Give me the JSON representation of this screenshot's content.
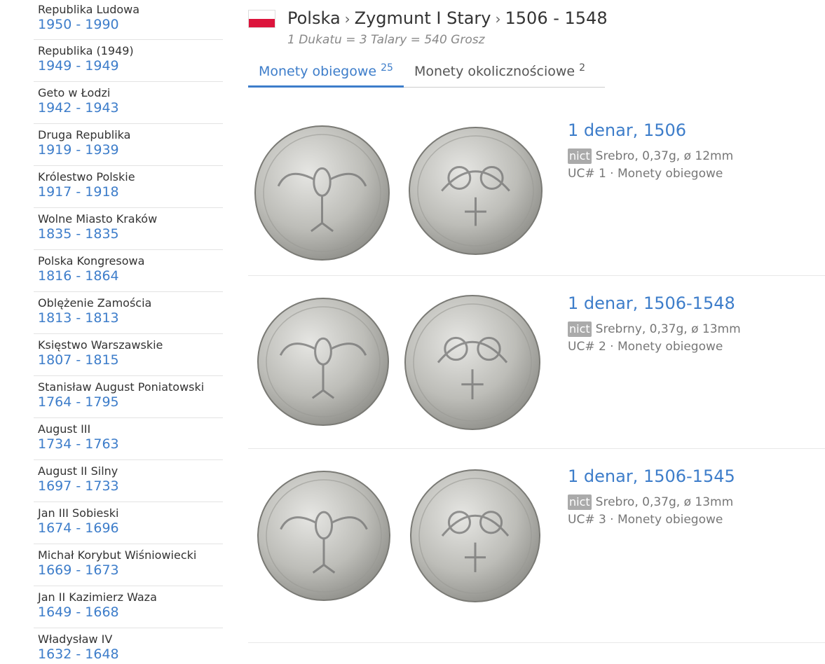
{
  "sidebar": {
    "periods": [
      {
        "name": "Republika Ludowa",
        "years": "1950 - 1990"
      },
      {
        "name": "Republika (1949)",
        "years": "1949 - 1949"
      },
      {
        "name": "Geto w Łodzi",
        "years": "1942 - 1943"
      },
      {
        "name": "Druga Republika",
        "years": "1919 - 1939"
      },
      {
        "name": "Królestwo Polskie",
        "years": "1917 - 1918"
      },
      {
        "name": "Wolne Miasto Kraków",
        "years": "1835 - 1835"
      },
      {
        "name": "Polska Kongresowa",
        "years": "1816 - 1864"
      },
      {
        "name": "Oblężenie Zamościa",
        "years": "1813 - 1813"
      },
      {
        "name": "Księstwo Warszawskie",
        "years": "1807 - 1815"
      },
      {
        "name": "Stanisław August Poniatowski",
        "years": "1764 - 1795"
      },
      {
        "name": "August III",
        "years": "1734 - 1763"
      },
      {
        "name": "August II Silny",
        "years": "1697 - 1733"
      },
      {
        "name": "Jan III Sobieski",
        "years": "1674 - 1696"
      },
      {
        "name": "Michał Korybut Wiśniowiecki",
        "years": "1669 - 1673"
      },
      {
        "name": "Jan II Kazimierz Waza",
        "years": "1649 - 1668"
      },
      {
        "name": "Władysław IV",
        "years": "1632 - 1648"
      }
    ]
  },
  "header": {
    "breadcrumb": [
      "Polska",
      "Zygmunt I Stary",
      "1506 - 1548"
    ],
    "separator": "›",
    "subtitle": "1 Dukatu = 3 Talary = 540 Grosz",
    "flag_colors": {
      "top": "#ffffff",
      "bottom": "#dc143c"
    }
  },
  "tabs": [
    {
      "label": "Monety obiegowe",
      "count": "25",
      "active": true
    },
    {
      "label": "Monety okolicznościowe",
      "count": "2",
      "active": false
    }
  ],
  "coins": [
    {
      "title": "1 denar, 1506",
      "badge": "nict",
      "spec": "Srebro, 0,37g, ø 12mm",
      "catalog": "UC# 1 · Monety obiegowe"
    },
    {
      "title": "1 denar, 1506-1548",
      "badge": "nict",
      "spec": "Srebrny, 0,37g, ø 13mm",
      "catalog": "UC# 2 · Monety obiegowe"
    },
    {
      "title": "1 denar, 1506-1545",
      "badge": "nict",
      "spec": "Srebro, 0,37g, ø 13mm",
      "catalog": "UC# 3 · Monety obiegowe"
    }
  ],
  "colors": {
    "link": "#3d7dca",
    "text": "#333333",
    "muted": "#777777",
    "badge": "#aaaaaa"
  }
}
